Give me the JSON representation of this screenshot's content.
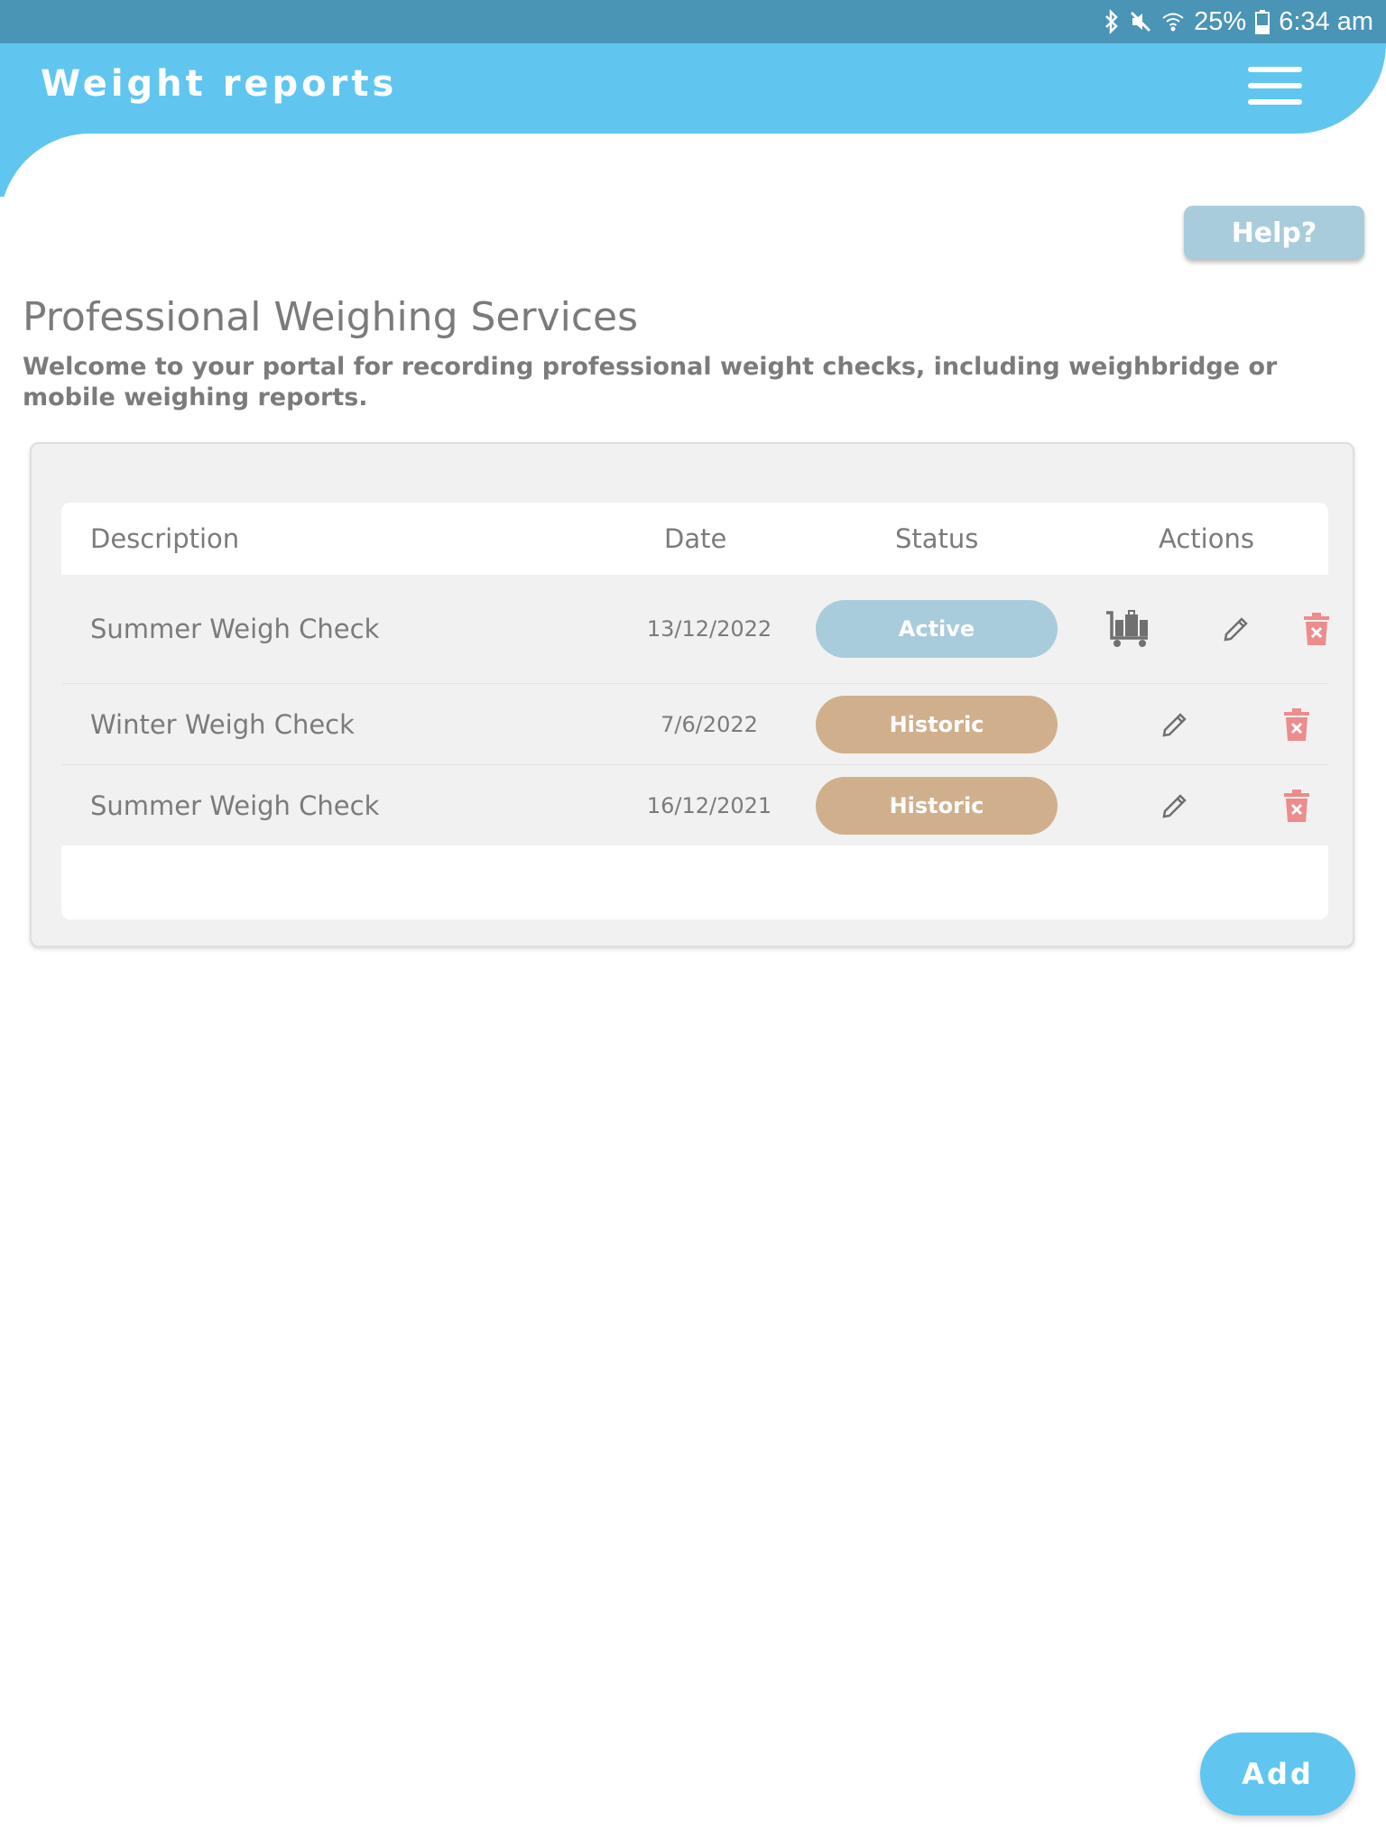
{
  "status_bar": {
    "battery": "25%",
    "time": "6:34 am",
    "icons": [
      "bluetooth-icon",
      "mute-icon",
      "wifi-icon",
      "battery-icon"
    ]
  },
  "header": {
    "title": "Weight reports",
    "menu_icon": "hamburger-menu-icon"
  },
  "help_button": {
    "label": "Help?"
  },
  "page": {
    "title": "Professional Weighing Services",
    "subtitle": "Welcome to your portal for recording professional weight checks, including weighbridge or mobile weighing reports."
  },
  "table": {
    "columns": [
      "Description",
      "Date",
      "Status",
      "Actions"
    ],
    "rows": [
      {
        "description": "Summer Weigh Check",
        "date": "13/12/2022",
        "status": "Active",
        "actions": [
          "luggage-trolley-icon",
          "pencil-icon",
          "trash-icon"
        ]
      },
      {
        "description": "Winter Weigh Check",
        "date": "7/6/2022",
        "status": "Historic",
        "actions": [
          "pencil-icon",
          "trash-icon"
        ]
      },
      {
        "description": "Summer Weigh Check",
        "date": "16/12/2021",
        "status": "Historic",
        "actions": [
          "pencil-icon",
          "trash-icon"
        ]
      }
    ]
  },
  "add_button": {
    "label": "Add"
  },
  "colors": {
    "status_bar": "#4a94b5",
    "header": "#60c6f0",
    "active_badge": "#a9ccdc",
    "historic_badge": "#d0b08c",
    "delete_icon": "#ec8c8c",
    "text": "#7b7b7b"
  }
}
